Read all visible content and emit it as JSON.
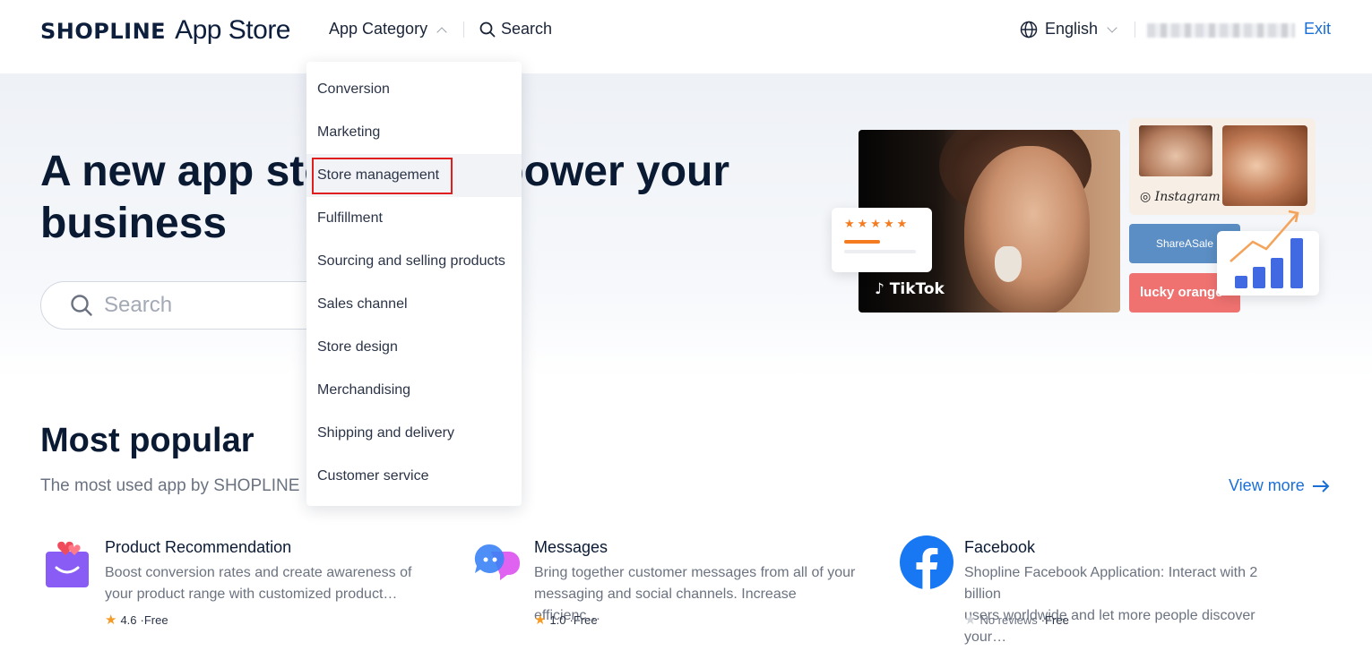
{
  "header": {
    "logo_brand": "SHOPLINE",
    "logo_app": "App Store",
    "category_label": "App Category",
    "search_label": "Search",
    "language_label": "English",
    "exit_label": "Exit"
  },
  "dropdown": {
    "items": [
      {
        "label": "Conversion"
      },
      {
        "label": "Marketing"
      },
      {
        "label": "Store management"
      },
      {
        "label": "Fulfillment"
      },
      {
        "label": "Sourcing and selling products"
      },
      {
        "label": "Sales channel"
      },
      {
        "label": "Store design"
      },
      {
        "label": "Merchandising"
      },
      {
        "label": "Shipping and delivery"
      },
      {
        "label": "Customer service"
      }
    ],
    "highlighted_index": 2
  },
  "hero": {
    "title": "A new app store to empower your business",
    "search_placeholder": "Search",
    "collage": {
      "tiktok_label": "TikTok",
      "instagram_label": "Instagram",
      "shareasale_label": "ShareASale",
      "lucky_orange_label": "lucky orange"
    }
  },
  "most_popular": {
    "title": "Most popular",
    "subtitle": "The most used app by SHOPLINE",
    "view_more": "View more",
    "apps": [
      {
        "name": "Product Recommendation",
        "desc_line1": "Boost conversion rates and create awareness of",
        "desc_line2": "your product range with customized product…",
        "rating": "4.6",
        "price": "·Free"
      },
      {
        "name": "Messages",
        "desc_line1": "Bring together customer messages from all of your",
        "desc_line2": "messaging and social channels. Increase efficienc…",
        "rating": "1.0",
        "price": "·Free"
      },
      {
        "name": "Facebook",
        "desc_line1": "Shopline Facebook Application: Interact with 2 billion",
        "desc_line2": "users worldwide and let more people discover your…",
        "rating": "No reviews",
        "price": "·Free"
      }
    ]
  },
  "colors": {
    "accent_blue": "#1a6ed8",
    "highlight_red": "#e01e1e",
    "star_orange": "#f59a23"
  }
}
